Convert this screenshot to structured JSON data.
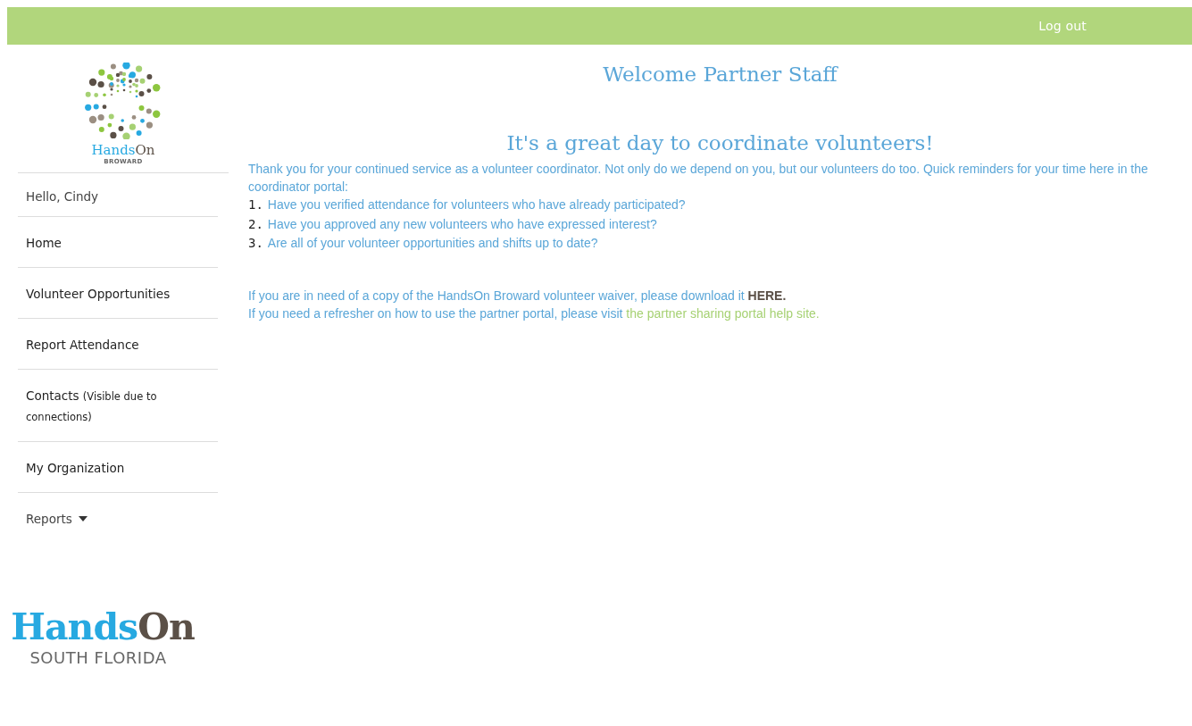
{
  "top_bar": {
    "logout": "Log out"
  },
  "sidebar": {
    "logo": {
      "hands": "Hands",
      "on": "On",
      "subtitle": "BROWARD"
    },
    "greeting": "Hello, Cindy",
    "items": [
      {
        "label": "Home",
        "kind": "link"
      },
      {
        "label": "Volunteer Opportunities",
        "kind": "link"
      },
      {
        "label": "Report Attendance",
        "kind": "link"
      },
      {
        "label": "Contacts",
        "note": "(Visible due to connections)",
        "kind": "link"
      },
      {
        "label": "My Organization",
        "kind": "link"
      },
      {
        "label": "Reports",
        "kind": "dropdown"
      }
    ],
    "footer_logo": {
      "hands": "Hands",
      "on": "On",
      "subtitle": "SOUTH FLORIDA"
    }
  },
  "main": {
    "title": "Welcome Partner Staff",
    "subtitle": "It's a great day to coordinate volunteers!",
    "intro": "Thank you for your continued service as a volunteer coordinator. Not only do we depend on you, but our volunteers do too. Quick reminders for your time here in the coordinator portal:",
    "reminders": [
      {
        "number": "1.",
        "text": "Have you verified attendance for volunteers who have already participated?"
      },
      {
        "number": "2.",
        "text": "Have you approved any new volunteers who have expressed interest?"
      },
      {
        "number": "3.",
        "text": "Are all of your volunteer opportunities and shifts up to date?"
      }
    ],
    "waiver": {
      "text": "If you are in need of a copy of the HandsOn Broward volunteer waiver, please download it ",
      "link": "HERE."
    },
    "help": {
      "text": "If you need a refresher on how to use the partner portal, please visit ",
      "link": "the partner sharing portal help site."
    }
  }
}
